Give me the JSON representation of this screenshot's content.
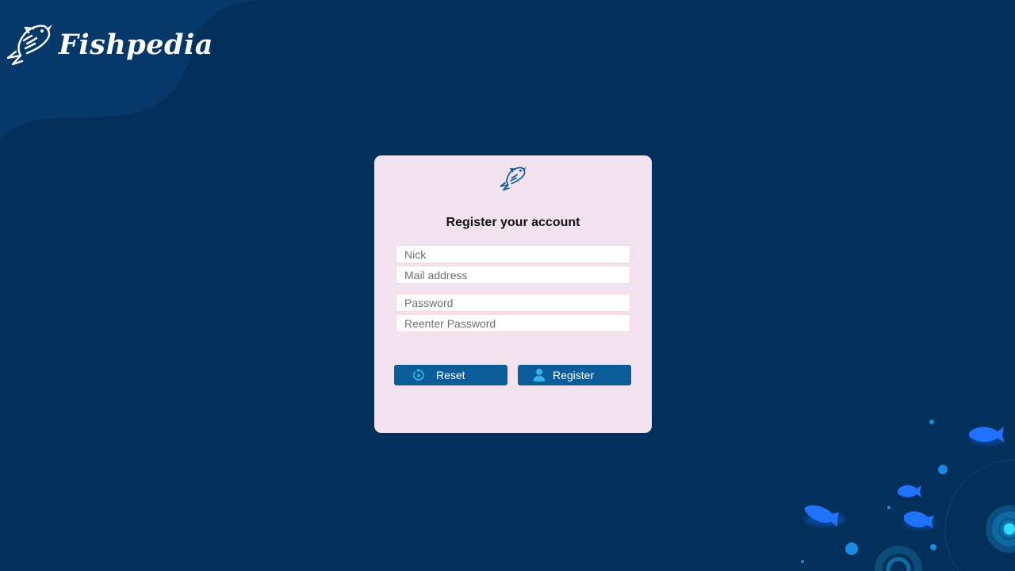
{
  "brand": {
    "name": "Fishpedia"
  },
  "register_form": {
    "title": "Register your account",
    "nick": {
      "placeholder": "Nick",
      "value": ""
    },
    "mail": {
      "placeholder": "Mail address",
      "value": ""
    },
    "password": {
      "placeholder": "Password",
      "value": ""
    },
    "reenter_password": {
      "placeholder": "Reenter Password",
      "value": ""
    },
    "reset_label": "Reset",
    "register_label": "Register"
  },
  "icons": {
    "brand_logo": "fish-logo-icon",
    "card_logo": "fish-logo-icon",
    "reset": "reset-icon",
    "register": "user-icon"
  },
  "colors": {
    "background": "#03305a",
    "corner_blob": "#07386a",
    "card": "#f2e3ef",
    "button": "#0a5d98",
    "button_icon": "#3ab3e8",
    "fish_accent": "#1e6cff"
  }
}
